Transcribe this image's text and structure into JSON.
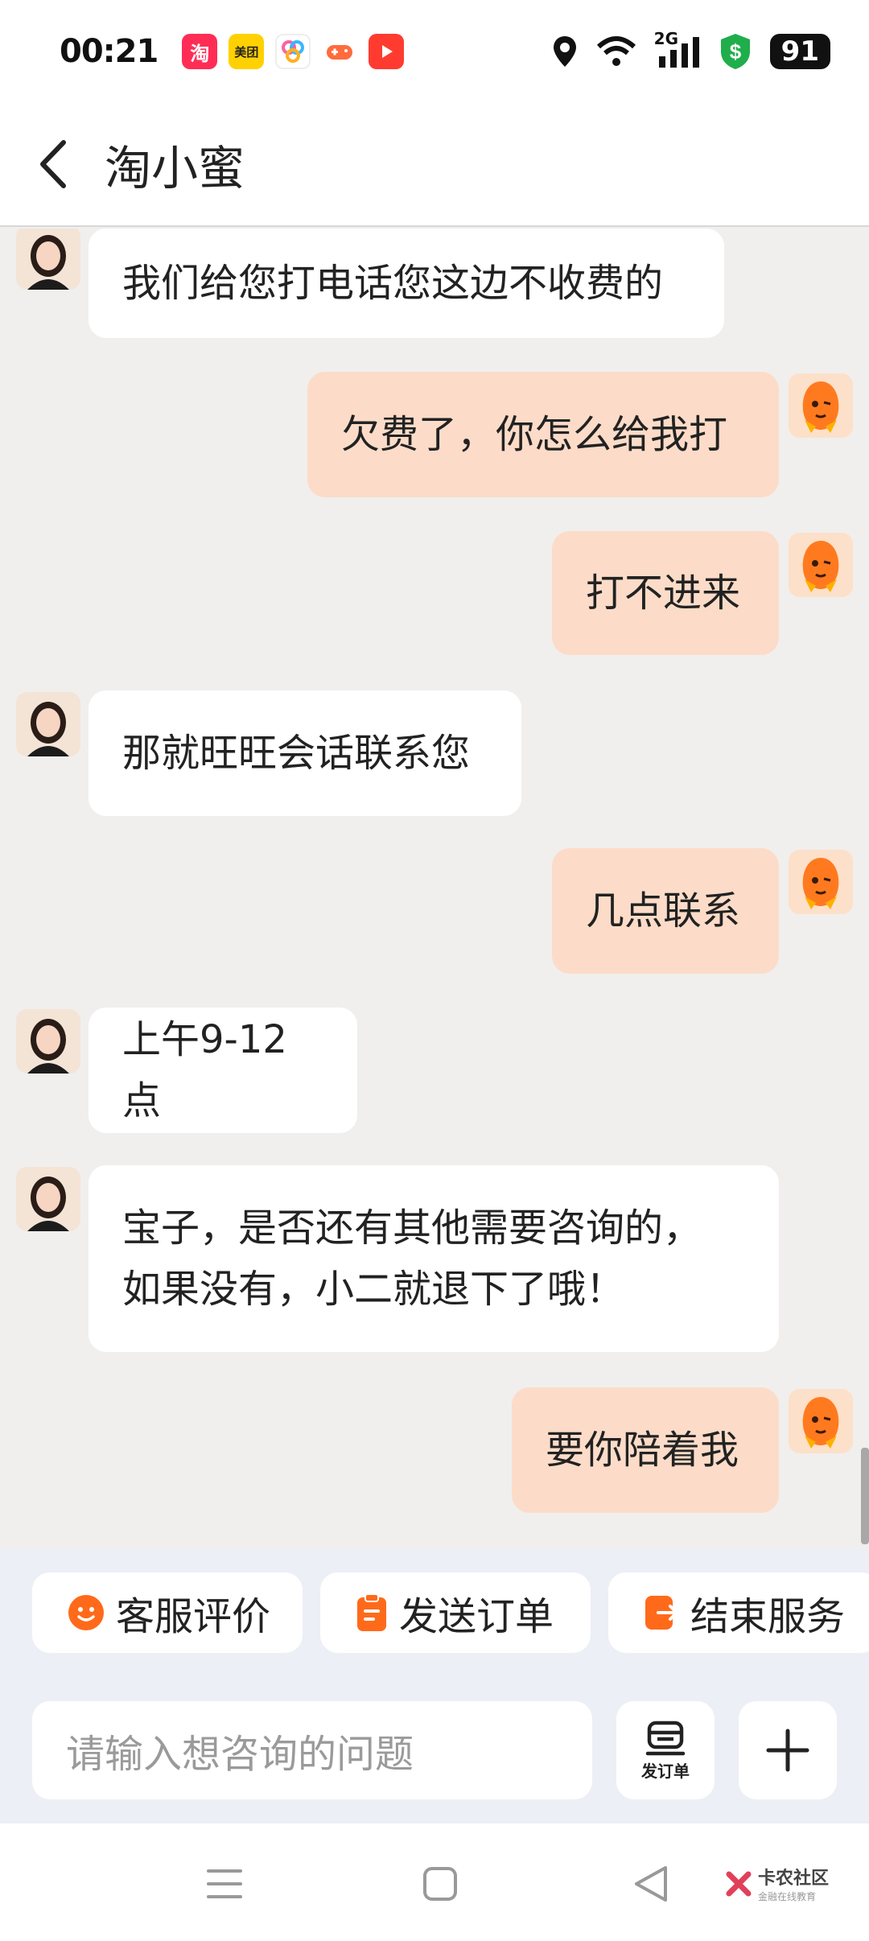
{
  "status_bar": {
    "time": "00:21",
    "network": "2G",
    "battery": "91",
    "app_icons": [
      "taobao-icon",
      "meituan-icon",
      "app-icon",
      "game-icon",
      "video-icon"
    ],
    "meituan_label": "美团",
    "taobao_label": "淘"
  },
  "header": {
    "title": "淘小蜜"
  },
  "messages": [
    {
      "from": "agent",
      "text": "我们给您打电话您这边不收费的"
    },
    {
      "from": "user",
      "text": "欠费了，你怎么给我打"
    },
    {
      "from": "user",
      "text": "打不进来"
    },
    {
      "from": "agent",
      "text": "那就旺旺会话联系您"
    },
    {
      "from": "user",
      "text": "几点联系"
    },
    {
      "from": "agent",
      "text": "上午9-12点"
    },
    {
      "from": "agent",
      "text_line1": "宝子，是否还有其他需要咨询的，",
      "text_line2": "如果没有，小二就退下了哦！"
    },
    {
      "from": "user",
      "text": "要你陪着我"
    }
  ],
  "quick_actions": [
    {
      "label": "客服评价",
      "icon": "smile-icon"
    },
    {
      "label": "发送订单",
      "icon": "clipboard-icon"
    },
    {
      "label": "结束服务",
      "icon": "exit-icon"
    }
  ],
  "input": {
    "placeholder": "请输入想咨询的问题",
    "order_button_label": "发订单"
  },
  "watermark": {
    "title": "卡农社区",
    "subtitle": "金融在线教育"
  },
  "colors": {
    "user_bubble": "#fcdcc8",
    "agent_bubble": "#ffffff",
    "accent": "#ff6a1a",
    "background": "#f0efed"
  }
}
